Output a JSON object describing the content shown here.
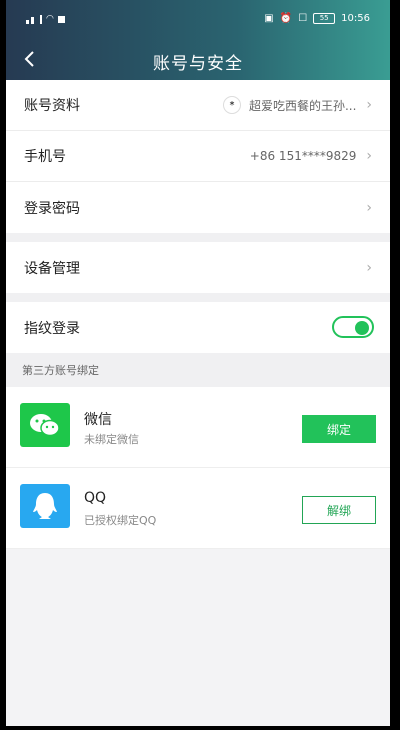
{
  "status_bar": {
    "time": "10:56",
    "battery": "55"
  },
  "header": {
    "title": "账号与安全"
  },
  "account_group": [
    {
      "label": "账号资料",
      "value": "超爱吃西餐的王孙..."
    },
    {
      "label": "手机号",
      "value": "+86 151****9829"
    },
    {
      "label": "登录密码",
      "value": ""
    }
  ],
  "device_group": [
    {
      "label": "设备管理"
    }
  ],
  "fingerprint": {
    "label": "指纹登录",
    "enabled": true
  },
  "third_party": {
    "heading": "第三方账号绑定",
    "items": [
      {
        "name": "微信",
        "status": "未绑定微信",
        "action": "绑定",
        "icon": "wechat-icon",
        "bound": false
      },
      {
        "name": "QQ",
        "status": "已授权绑定QQ",
        "action": "解绑",
        "icon": "qq-icon",
        "bound": true
      }
    ]
  },
  "colors": {
    "accent": "#22c25a",
    "header_start": "#263a52",
    "header_end": "#3a9d93"
  }
}
